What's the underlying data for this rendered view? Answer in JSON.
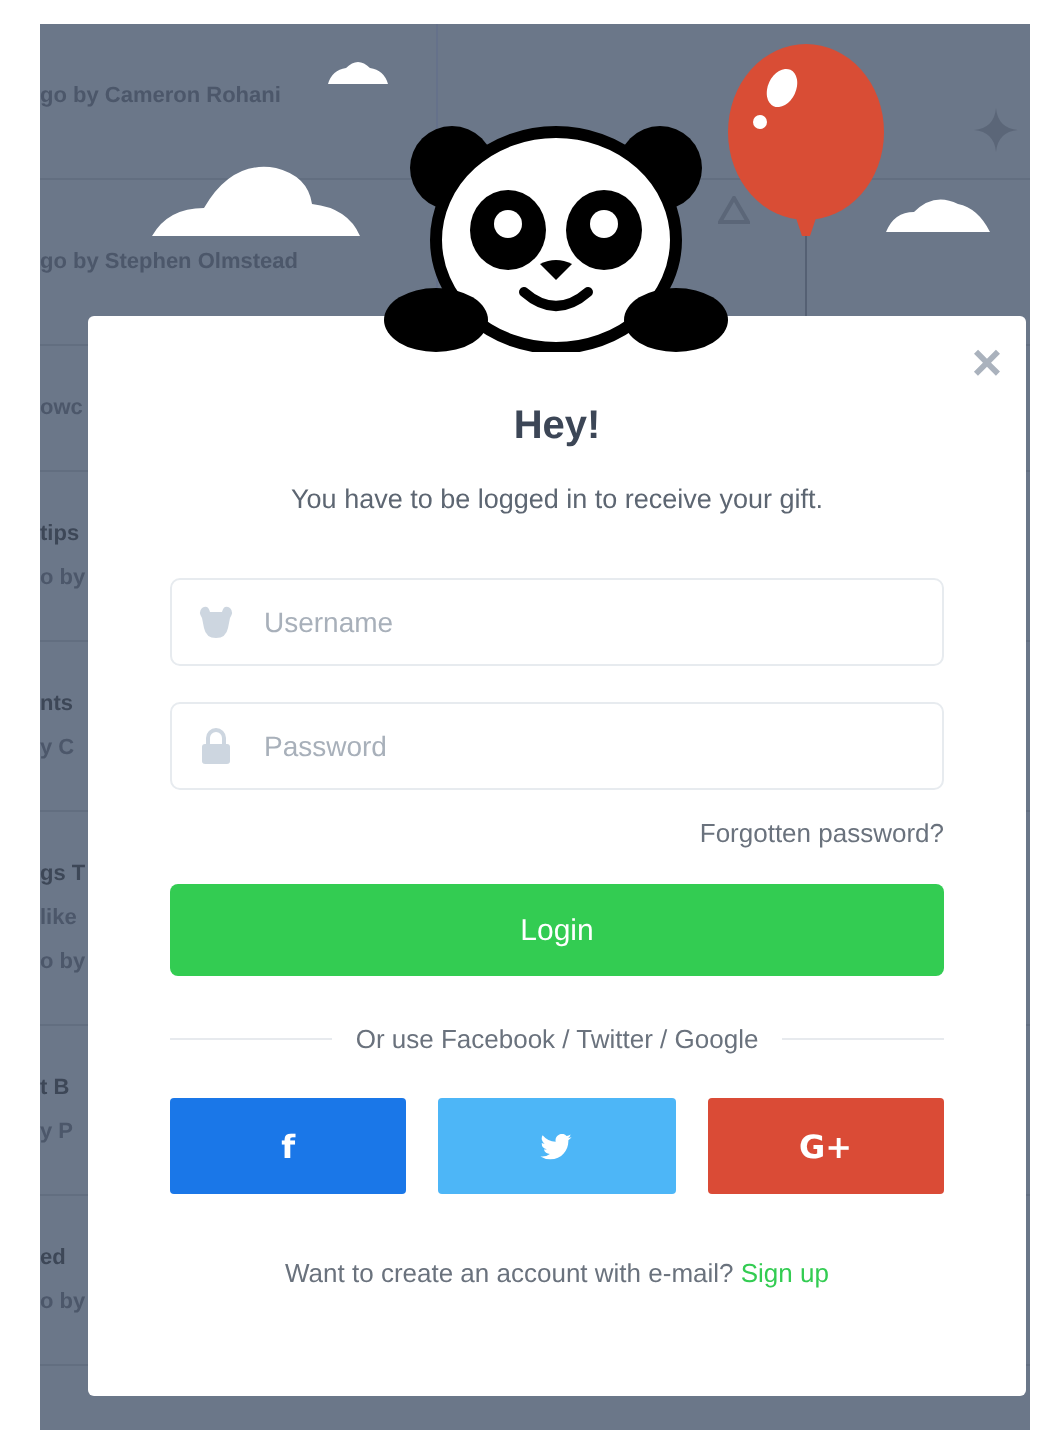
{
  "background_list": [
    {
      "lines": [
        "go by Cameron Rohani"
      ]
    },
    {
      "lines": [
        "go by Stephen Olmstead"
      ]
    },
    {
      "lines": [
        "owc"
      ]
    },
    {
      "lines": [
        "tips",
        "o by"
      ]
    },
    {
      "lines": [
        "nts",
        "y C"
      ]
    },
    {
      "lines": [
        "gs T",
        "like",
        "o by"
      ]
    },
    {
      "lines": [
        "t B",
        "y P"
      ]
    },
    {
      "lines": [
        "ed",
        "o by"
      ]
    }
  ],
  "dialog": {
    "close": "×",
    "title": "Hey!",
    "subtitle": "You have to be logged in to receive your gift.",
    "fields": [
      {
        "kind": "user",
        "placeholder": "Username"
      },
      {
        "kind": "password",
        "placeholder": "Password"
      }
    ],
    "forgot_link": "Forgotten password?",
    "login_button": "Login",
    "divider_text": "Or use Facebook / Twitter / Google",
    "social_buttons": [
      {
        "kind": "facebook",
        "label": "f",
        "color": "#1a77e8"
      },
      {
        "kind": "twitter",
        "color": "#4db6f7"
      },
      {
        "kind": "google",
        "label": "G+",
        "color": "#da4b36"
      }
    ],
    "signup_prompt": "Want to create an account with e-mail?",
    "signup_link": "Sign up"
  }
}
